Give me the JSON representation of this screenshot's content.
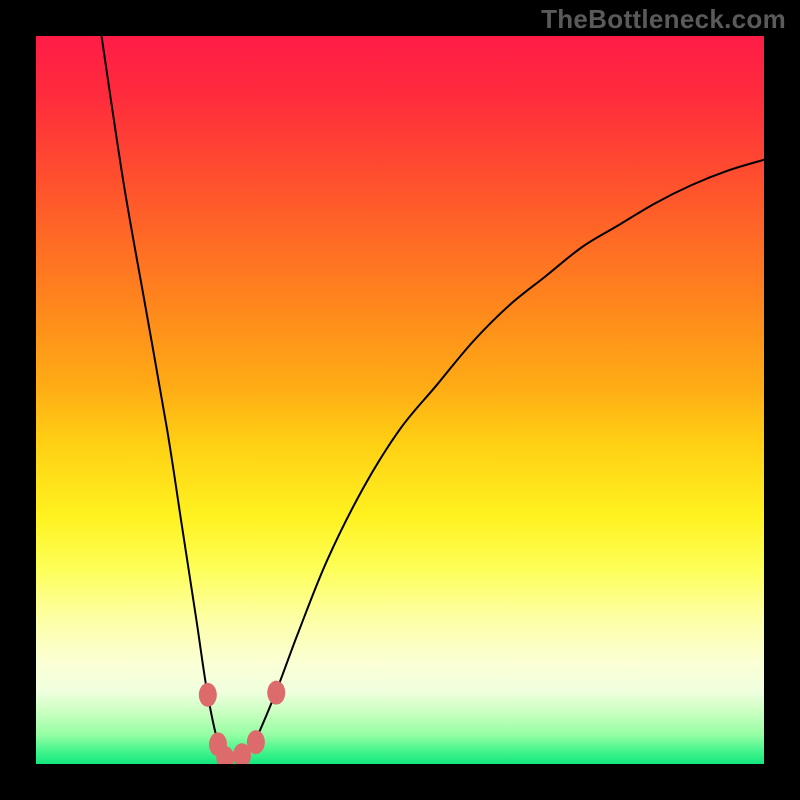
{
  "watermark": "TheBottleneck.com",
  "chart_data": {
    "type": "line",
    "title": "",
    "xlabel": "",
    "ylabel": "",
    "xlim": [
      0,
      100
    ],
    "ylim": [
      0,
      100
    ],
    "series": [
      {
        "name": "curve",
        "x": [
          9,
          12,
          15,
          18,
          20,
          22,
          23.5,
          25,
          26.5,
          28,
          30,
          33,
          36,
          40,
          45,
          50,
          55,
          60,
          65,
          70,
          75,
          80,
          85,
          90,
          95,
          100
        ],
        "values": [
          100,
          80,
          63,
          46,
          33,
          20,
          10,
          3,
          0,
          0,
          3,
          10,
          18,
          28,
          38,
          46,
          52,
          58,
          63,
          67,
          71,
          74,
          77,
          79.5,
          81.5,
          83
        ]
      }
    ],
    "markers": [
      {
        "x": 23.6,
        "y": 9.5
      },
      {
        "x": 25.0,
        "y": 2.7
      },
      {
        "x": 26.0,
        "y": 0.8
      },
      {
        "x": 28.3,
        "y": 1.2
      },
      {
        "x": 30.2,
        "y": 3.0
      },
      {
        "x": 33.0,
        "y": 9.8
      }
    ],
    "colors": {
      "curve": "#000000",
      "marker": "#dd6b6b"
    }
  }
}
